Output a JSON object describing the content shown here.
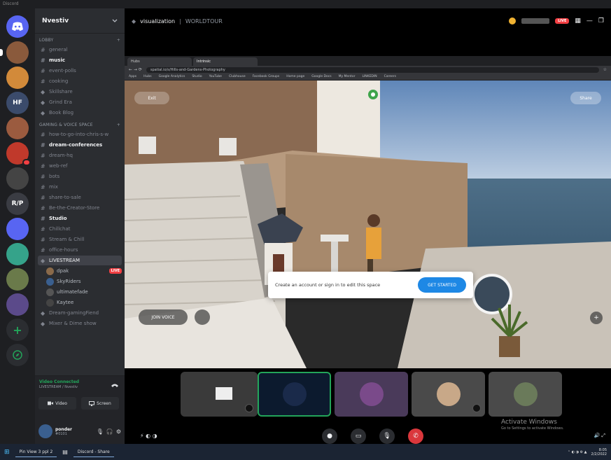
{
  "titlebar": {
    "app_name": "Discord"
  },
  "servers": [
    {
      "initials": "",
      "color": "#5865f2",
      "badge": ""
    },
    {
      "initials": "",
      "color": "#8a5a3c",
      "badge": ""
    },
    {
      "initials": "",
      "color": "#d28a3a",
      "badge": ""
    },
    {
      "initials": "HF",
      "color": "#3b4b6b",
      "badge": ""
    },
    {
      "initials": "",
      "color": "#9b5b3f",
      "badge": ""
    },
    {
      "initials": "",
      "color": "#c0392b",
      "badge": ""
    },
    {
      "initials": "",
      "color": "#444",
      "badge": ""
    },
    {
      "initials": "R/P",
      "color": "#3a3c43",
      "badge": ""
    },
    {
      "initials": "",
      "color": "#5865f2",
      "badge": ""
    },
    {
      "initials": "",
      "color": "#35a38a",
      "badge": ""
    },
    {
      "initials": "",
      "color": "#6a7a4a",
      "badge": ""
    },
    {
      "initials": "",
      "color": "#5b4a8a",
      "badge": ""
    }
  ],
  "sidebar": {
    "server_name": "Nvestiv",
    "category1": "LOBBY",
    "channels1": [
      "general",
      "music",
      "event-polls",
      "cooking",
      "Skillshare",
      "Grind Era",
      "Book Blog"
    ],
    "category2": "GAMING & VOICE SPACE",
    "channels2": [
      "how-to-go-into-chris-s-w",
      "dream-conferences",
      "dream-hq",
      "web-ref",
      "bots",
      "mix",
      "share-to-sale",
      "Be-the-Creator-Store",
      "Studio",
      "Chillchat",
      "Stream & Chill",
      "office-hours",
      "LIVESTREAM"
    ],
    "voice_users": [
      {
        "name": "dpak",
        "live": "LIVE"
      },
      {
        "name": "SkyRiders",
        "live": ""
      },
      {
        "name": "ultimatefade",
        "live": ""
      },
      {
        "name": "Kaytee",
        "live": ""
      }
    ],
    "more_channels": [
      "Dream-gamingFiend",
      "Mixer & Dime show"
    ],
    "voice_status": "Video Connected",
    "voice_sub": "LIVESTREAM / Nvestiv",
    "video_btn": "Video",
    "screen_btn": "Screen",
    "user_name": "ponder",
    "user_tag": "#0101"
  },
  "topbar": {
    "channel": "visualization",
    "guild": "WORLDTOUR",
    "live_label": "LIVE"
  },
  "browser": {
    "tabs": [
      "Hubs",
      "Intrinsic"
    ],
    "url": "spatial.io/s/Hills-and-Gardens-Photography",
    "bookmarks": [
      "Apps",
      "Hubs",
      "Google Analytics",
      "Studio",
      "YouTube",
      "Clubhouse",
      "Facebook Groups",
      "Home page",
      "Google Docs",
      "My Mentor",
      "LINKEDIN",
      "Careers"
    ]
  },
  "scene": {
    "exit_label": "Exit",
    "share_label": "Share",
    "join_label": "JOIN VOICE",
    "toast_text": "Create an account or sign in to edit this space",
    "toast_button": "GET STARTED"
  },
  "strip": {
    "watermark_title": "Activate Windows",
    "watermark_sub": "Go to Settings to activate Windows."
  },
  "taskbar": {
    "search": "Pin View 3 ppl 2",
    "app_label": "Discord - Share",
    "time": "8:05",
    "date": "2/2/2022"
  }
}
